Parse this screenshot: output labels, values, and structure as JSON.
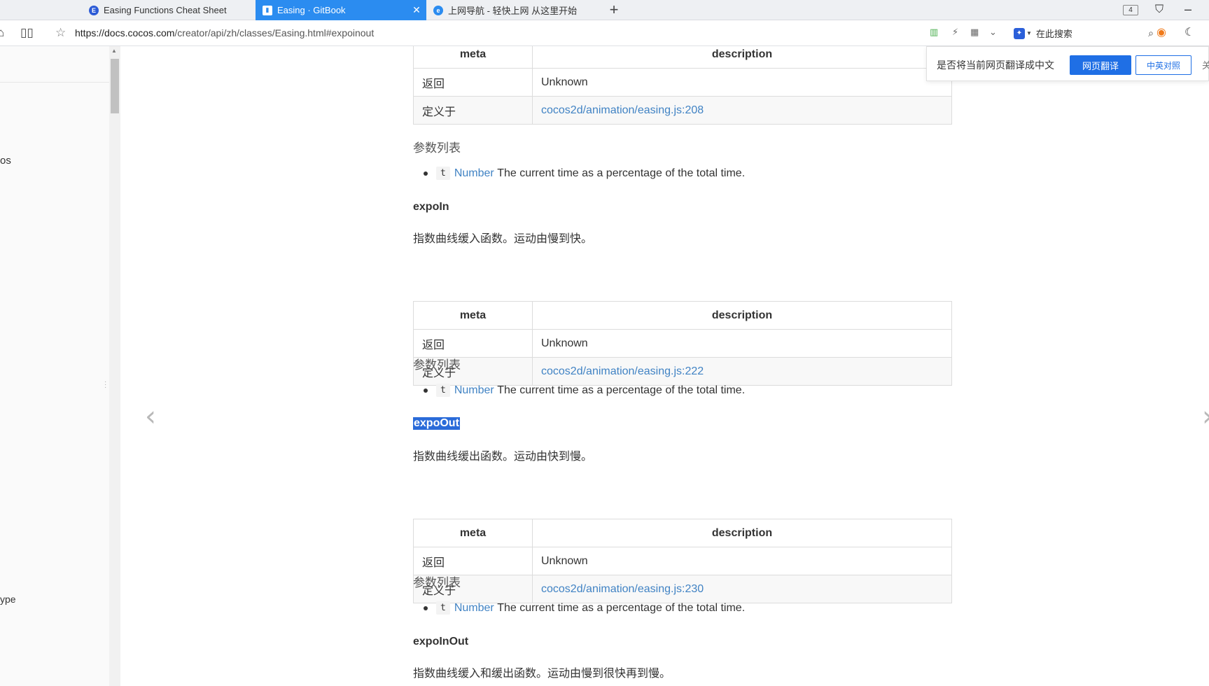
{
  "tabs": [
    {
      "title": "Easing Functions Cheat Sheet",
      "icon": "easings-favicon"
    },
    {
      "title": "Easing · GitBook",
      "icon": "gitbook-favicon",
      "active": true
    },
    {
      "title": "上网导航 - 轻快上网 从这里开始",
      "icon": "browser-e-favicon"
    }
  ],
  "tab_count": "4",
  "url": {
    "host": "https://docs.cocos.com",
    "path": "/creator/api/zh/classes/Easing.html#expoinout"
  },
  "search_placeholder": "在此搜索",
  "sidebar": {
    "trunc_top": "os",
    "trunc_bottom": "ype"
  },
  "translate_bar": {
    "question": "是否将当前网页翻译成中文",
    "translate_btn": "网页翻译",
    "bilingual_btn": "中英对照",
    "close": "关"
  },
  "sections": [
    {
      "table": {
        "header": [
          "meta",
          "description"
        ],
        "rows": [
          [
            "返回",
            "Unknown"
          ],
          [
            "定义于",
            "cocos2d/animation/easing.js:208"
          ]
        ]
      },
      "params_heading": "参数列表",
      "param": {
        "code": "t",
        "type": "Number",
        "text": "The current time as a percentage of the total time."
      }
    },
    {
      "title": "expoIn",
      "desc": "指数曲线缓入函数。运动由慢到快。",
      "table": {
        "header": [
          "meta",
          "description"
        ],
        "rows": [
          [
            "返回",
            "Unknown"
          ],
          [
            "定义于",
            "cocos2d/animation/easing.js:222"
          ]
        ]
      },
      "params_heading": "参数列表",
      "param": {
        "code": "t",
        "type": "Number",
        "text": "The current time as a percentage of the total time."
      }
    },
    {
      "title": "expoOut",
      "desc": "指数曲线缓出函数。运动由快到慢。",
      "table": {
        "header": [
          "meta",
          "description"
        ],
        "rows": [
          [
            "返回",
            "Unknown"
          ],
          [
            "定义于",
            "cocos2d/animation/easing.js:230"
          ]
        ]
      },
      "params_heading": "参数列表",
      "param": {
        "code": "t",
        "type": "Number",
        "text": "The current time as a percentage of the total time."
      }
    },
    {
      "title": "expoInOut",
      "desc": "指数曲线缓入和缓出函数。运动由慢到很快再到慢。"
    }
  ],
  "colors": {
    "accent": "#2b8cf0",
    "link": "#4183c4",
    "selection": "#2a6bd9"
  }
}
